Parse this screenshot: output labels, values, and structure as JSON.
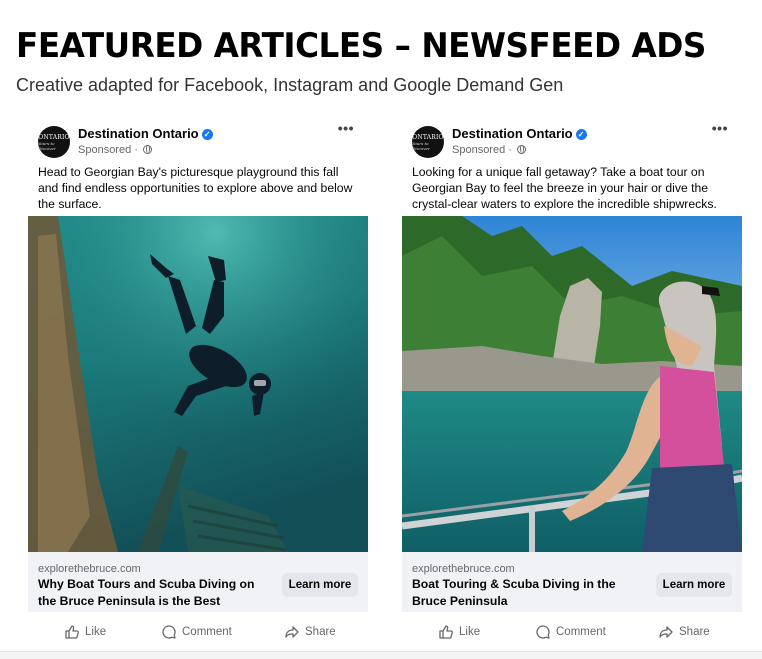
{
  "header": {
    "title": "FEATURED ARTICLES – NEWSFEED ADS",
    "subtitle": "Creative adapted for Facebook, Instagram and Google Demand Gen"
  },
  "ads": [
    {
      "page_name": "Destination Ontario",
      "sponsored": "Sponsored ·",
      "avatar_text": "ONTARIO",
      "avatar_tagline": "Yours to Discover",
      "primary_text": "Head to Georgian Bay's picturesque playground this fall and find endless opportunities to explore above and below the surface.",
      "domain": "explorethebruce.com",
      "headline": "Why Boat Tours and Scuba Diving on the Bruce Peninsula is the Best",
      "cta": "Learn more",
      "image": "underwater-diver-shipwreck"
    },
    {
      "page_name": "Destination Ontario",
      "sponsored": "Sponsored ·",
      "avatar_text": "ONTARIO",
      "avatar_tagline": "Yours to Discover",
      "primary_text": "Looking for a unique fall getaway? Take a boat tour on Georgian Bay to feel the breeze in your hair or dive the crystal-clear waters to explore the incredible shipwrecks.",
      "domain": "explorethebruce.com",
      "headline": "Boat Touring & Scuba Diving in the Bruce Peninsula",
      "cta": "Learn more",
      "image": "woman-on-boat-flowerpot-rock"
    }
  ],
  "actions": {
    "like": "Like",
    "comment": "Comment",
    "share": "Share"
  },
  "colors": {
    "verified": "#1877f2",
    "link_area_bg": "#f0f2f5",
    "cta_bg": "#e4e6eb",
    "meta_text": "#65676b"
  }
}
